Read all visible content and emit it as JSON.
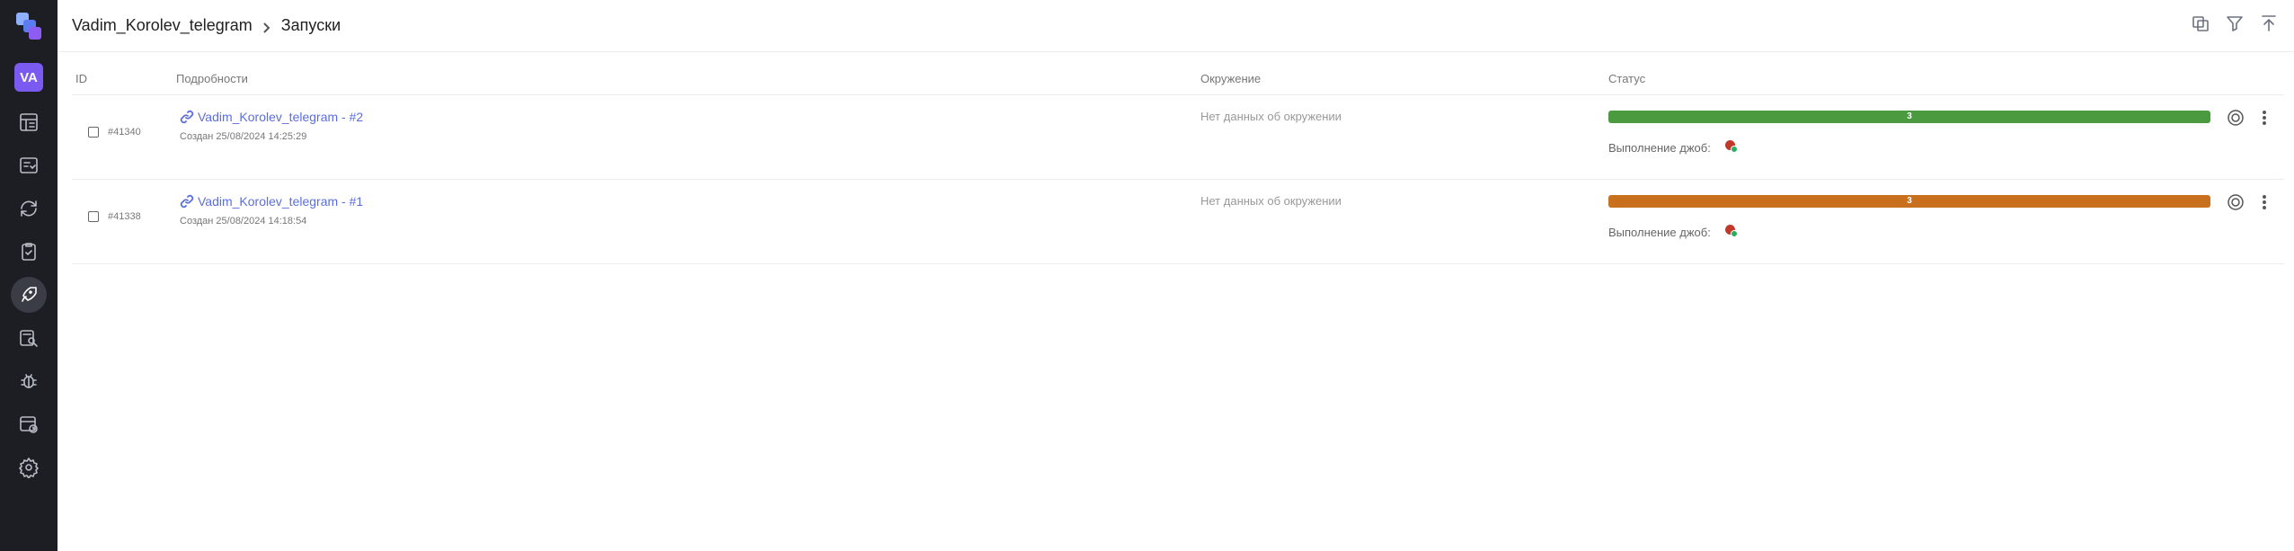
{
  "app": {
    "avatar_initials": "VA",
    "accent": "#7a5af0"
  },
  "sidebar": {
    "items": [
      {
        "icon": "dashboard-icon",
        "active": false
      },
      {
        "icon": "test-cases-icon",
        "active": false
      },
      {
        "icon": "sync-icon",
        "active": false
      },
      {
        "icon": "checklist-icon",
        "active": false
      },
      {
        "icon": "rocket-launch-icon",
        "active": true
      },
      {
        "icon": "search-report-icon",
        "active": false
      },
      {
        "icon": "bug-icon",
        "active": false
      },
      {
        "icon": "schedule-icon",
        "active": false
      },
      {
        "icon": "settings-icon",
        "active": false
      }
    ]
  },
  "header": {
    "project": "Vadim_Korolev_telegram",
    "page": "Запуски",
    "actions": [
      "compare-icon",
      "filter-icon",
      "upload-icon"
    ]
  },
  "table": {
    "columns": {
      "id": "ID",
      "details": "Подробности",
      "environment": "Окружение",
      "status": "Статус"
    },
    "rows": [
      {
        "id": "#41340",
        "name": "Vadim_Korolev_telegram - #2",
        "created": "Создан 25/08/2024 14:25:29",
        "environment": "Нет данных об окружении",
        "status_count": "3",
        "status_color": "#4c9a3f",
        "status_fill": 1.0,
        "jobs_label": "Выполнение джоб:"
      },
      {
        "id": "#41338",
        "name": "Vadim_Korolev_telegram - #1",
        "created": "Создан 25/08/2024 14:18:54",
        "environment": "Нет данных об окружении",
        "status_count": "3",
        "status_color": "#c9701f",
        "status_fill": 1.0,
        "jobs_label": "Выполнение джоб:"
      }
    ]
  }
}
